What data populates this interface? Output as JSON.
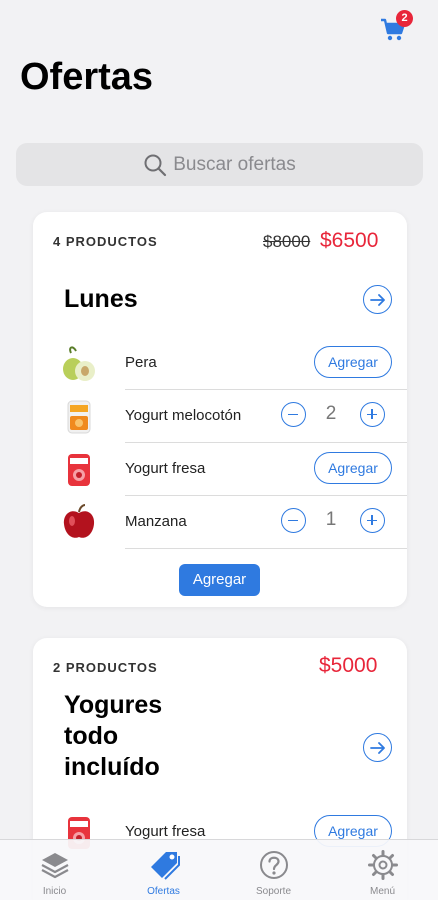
{
  "header": {
    "cart_badge": "2",
    "title": "Ofertas"
  },
  "search": {
    "placeholder": "Buscar ofertas"
  },
  "offers": [
    {
      "count_label": "4 PRODUCTOS",
      "old_price": "$8000",
      "new_price": "$6500",
      "title": "Lunes",
      "items": [
        {
          "name": "Pera",
          "action": "Agregar",
          "icon": "pear-icon"
        },
        {
          "name": "Yogurt melocotón",
          "quantity": "2",
          "icon": "peach-yogurt-icon"
        },
        {
          "name": "Yogurt fresa",
          "action": "Agregar",
          "icon": "strawberry-yogurt-icon"
        },
        {
          "name": "Manzana",
          "quantity": "1",
          "icon": "apple-icon"
        }
      ],
      "add_label": "Agregar"
    },
    {
      "count_label": "2 PRODUCTOS",
      "new_price": "$5000",
      "title_lines": [
        "Yogures",
        "todo",
        "incluído"
      ],
      "items": [
        {
          "name": "Yogurt fresa",
          "action": "Agregar",
          "icon": "strawberry-yogurt-icon"
        }
      ]
    }
  ],
  "tabbar": {
    "tabs": [
      {
        "label": "Inicio",
        "icon": "layers-icon"
      },
      {
        "label": "Ofertas",
        "icon": "pricetag-icon",
        "active": true
      },
      {
        "label": "Soporte",
        "icon": "help-circle-icon"
      },
      {
        "label": "Menú",
        "icon": "gear-icon"
      }
    ]
  },
  "colors": {
    "accent": "#2f7ae0",
    "price": "#e8263a",
    "background": "#f2f2f4"
  }
}
